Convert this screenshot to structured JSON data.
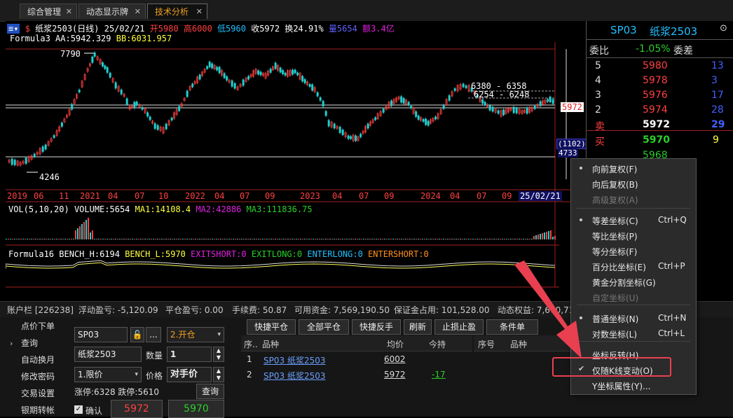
{
  "tabs": [
    {
      "label": "综合管理",
      "close": "✕"
    },
    {
      "label": "动态显示牌",
      "close": "✕"
    },
    {
      "label": "技术分析",
      "close": "✕"
    }
  ],
  "chart_header": {
    "title": "纸浆2503(日线) 25/02/21",
    "open": "开5980",
    "high": "高6000",
    "low": "低5960",
    "close": "收5972",
    "turnover": "换24.91%",
    "vol": "量5654",
    "amount": "额3.4亿",
    "formula": "Formula3",
    "aa": "AA:5942.329",
    "bb": "BB:6031.957"
  },
  "price_labels": {
    "p7790": "7790",
    "p4246": "4246",
    "p6380": "6380 - 6358",
    "p6254": "6254 - 6248",
    "current": "5972",
    "pos1": "(1102)",
    "pos2": "4733"
  },
  "time_axis": [
    "2019",
    "06",
    "11",
    "2021",
    "04",
    "07",
    "10",
    "2022",
    "04",
    "07",
    "09",
    "2023",
    "04",
    "07",
    "09",
    "2024",
    "04",
    "07",
    "09"
  ],
  "time_cursor": "25/02/21",
  "vol_line": {
    "label": "VOL(5,10,20)",
    "volume": "VOLUME:5654",
    "ma1": "MA1:14108.4",
    "ma2": "MA2:42886",
    "ma3": "MA3:111836.75"
  },
  "formula_line": {
    "label": "Formula16",
    "bench_h": "BENCH_H:6194",
    "bench_l": "BENCH_L:5970",
    "exitshort": "EXITSHORT:0",
    "exitlong": "EXITLONG:0",
    "enterlong": "ENTERLONG:0",
    "entershort": "ENTERSHORT:0"
  },
  "quote": {
    "code": "SP03",
    "name": "纸浆2503",
    "ratio_label": "委比",
    "ratio": "-1.05%",
    "diff_label": "委差",
    "asks": [
      {
        "lvl": "5",
        "price": "5980",
        "vol": "13"
      },
      {
        "lvl": "4",
        "price": "5978",
        "vol": "3"
      },
      {
        "lvl": "3",
        "price": "5976",
        "vol": "17"
      },
      {
        "lvl": "2",
        "price": "5974",
        "vol": "28"
      },
      {
        "lvl": "卖",
        "price": "5972",
        "vol": "29"
      }
    ],
    "bid_label": "买",
    "bid_price": "5970",
    "bid_vol": "9",
    "bid2_price": "5968"
  },
  "account": {
    "label": "账户栏 [226238]",
    "float_pl": "浮动盈亏: -5,120.09",
    "close_pl": "平仓盈亏: 0.00",
    "fee": "手续费: 50.87",
    "available": "可用资金: 7,569,190.50",
    "margin": "保证金占用: 101,528.00",
    "equity": "动态权益: 7,670,71"
  },
  "nav": [
    "点价下单",
    "查询",
    "自动换月",
    "修改密码",
    "交易设置",
    "银期转帐"
  ],
  "order": {
    "code": "SP03",
    "name": "纸浆2503",
    "action": "2.开仓",
    "qty_label": "数量",
    "qty": "1",
    "type": "1.限价",
    "price_label": "价格",
    "price": "对手价",
    "limits": "涨停:6328 跌停:5610",
    "query": "查询",
    "confirm": "确认",
    "sell": "5972",
    "buy": "5970"
  },
  "toolbar": [
    "快捷平仓",
    "全部平仓",
    "快捷反手",
    "刷新",
    "止损止盈",
    "条件单"
  ],
  "positions": {
    "headers": [
      "序..",
      "品种",
      "均价",
      "今持"
    ],
    "rows": [
      {
        "idx": "1",
        "name": "SP03 纸浆2503",
        "avg": "6002",
        "today": ""
      },
      {
        "idx": "2",
        "name": "SP03 纸浆2503",
        "avg": "5972",
        "today": "-17"
      }
    ]
  },
  "orders_headers": [
    "序号",
    "品种"
  ],
  "menu": [
    {
      "label": "向前复权(F)",
      "shortcut": "",
      "mark": "dot",
      "disabled": false
    },
    {
      "label": "向后复权(B)",
      "shortcut": "",
      "mark": "",
      "disabled": false
    },
    {
      "label": "高级复权(A)",
      "shortcut": "",
      "mark": "",
      "disabled": true
    },
    {
      "label": "等差坐标(C)",
      "shortcut": "Ctrl+Q",
      "mark": "dot",
      "disabled": false
    },
    {
      "label": "等比坐标(P)",
      "shortcut": "",
      "mark": "",
      "disabled": false
    },
    {
      "label": "等分坐标(F)",
      "shortcut": "",
      "mark": "",
      "disabled": false
    },
    {
      "label": "百分比坐标(E)",
      "shortcut": "Ctrl+P",
      "mark": "",
      "disabled": false
    },
    {
      "label": "黄金分割坐标(G)",
      "shortcut": "",
      "mark": "",
      "disabled": false
    },
    {
      "label": "自定坐标(U)",
      "shortcut": "",
      "mark": "",
      "disabled": true
    },
    {
      "label": "普通坐标(N)",
      "shortcut": "Ctrl+N",
      "mark": "dot",
      "disabled": false
    },
    {
      "label": "对数坐标(L)",
      "shortcut": "Ctrl+L",
      "mark": "",
      "disabled": false
    },
    {
      "label": "坐标反转(H)",
      "shortcut": "",
      "mark": "",
      "disabled": false
    },
    {
      "label": "仅随K线变动(O)",
      "shortcut": "",
      "mark": "check",
      "disabled": false
    },
    {
      "label": "Y坐标属性(Y)...",
      "shortcut": "",
      "mark": "",
      "disabled": false
    }
  ],
  "colors": {
    "up": "#ff4040",
    "down": "#20d0d0",
    "accent": "#f0a020",
    "highlight": "#e84050"
  }
}
